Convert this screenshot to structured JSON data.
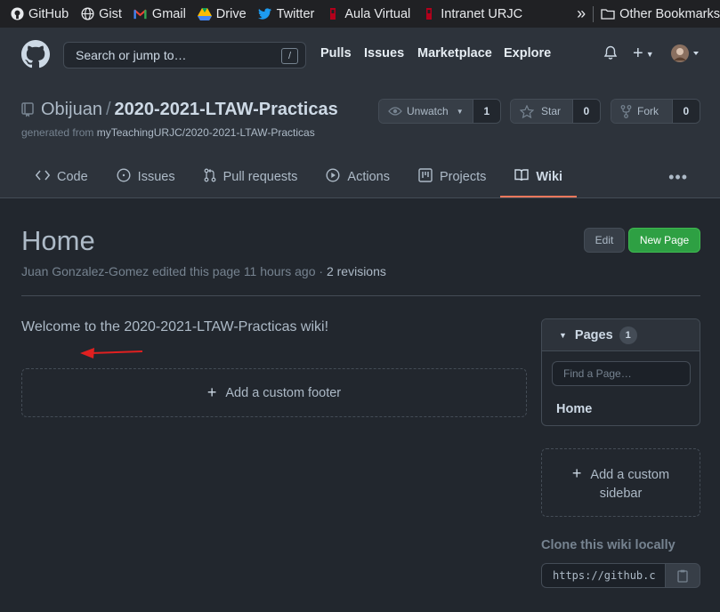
{
  "bookmarks": {
    "items": [
      {
        "label": "GitHub",
        "icon": "github-icon"
      },
      {
        "label": "Gist",
        "icon": "globe-icon"
      },
      {
        "label": "Gmail",
        "icon": "gmail-icon"
      },
      {
        "label": "Drive",
        "icon": "drive-icon"
      },
      {
        "label": "Twitter",
        "icon": "twitter-icon"
      },
      {
        "label": "Aula Virtual",
        "icon": "urjc-icon"
      },
      {
        "label": "Intranet URJC",
        "icon": "urjc-icon"
      }
    ],
    "other_label": "Other Bookmarks"
  },
  "header": {
    "search_placeholder": "Search or jump to…",
    "slash_key": "/",
    "nav": [
      "Pulls",
      "Issues",
      "Marketplace",
      "Explore"
    ]
  },
  "repo": {
    "owner": "Obijuan",
    "separator": "/",
    "name": "2020-2021-LTAW-Practicas",
    "generated_prefix": "generated from ",
    "generated_link": "myTeachingURJC/2020-2021-LTAW-Practicas",
    "unwatch_label": "Unwatch",
    "unwatch_count": "1",
    "star_label": "Star",
    "star_count": "0",
    "fork_label": "Fork",
    "fork_count": "0"
  },
  "tabs": [
    {
      "label": "Code",
      "icon": "code-icon"
    },
    {
      "label": "Issues",
      "icon": "issue-icon"
    },
    {
      "label": "Pull requests",
      "icon": "pull-request-icon"
    },
    {
      "label": "Actions",
      "icon": "play-icon"
    },
    {
      "label": "Projects",
      "icon": "project-icon"
    },
    {
      "label": "Wiki",
      "icon": "book-icon",
      "active": true
    }
  ],
  "wiki": {
    "title": "Home",
    "meta_text": "Juan Gonzalez-Gomez edited this page 11 hours ago · ",
    "revisions_link": "2 revisions",
    "edit_label": "Edit",
    "new_page_label": "New Page",
    "welcome": "Welcome to the 2020-2021-LTAW-Practicas wiki!",
    "add_footer": "Add a custom footer"
  },
  "sidebar": {
    "pages_label": "Pages",
    "pages_count": "1",
    "find_placeholder": "Find a Page…",
    "pages": [
      "Home"
    ],
    "add_sidebar_line1": "Add a custom",
    "add_sidebar_line2": "sidebar",
    "clone_title": "Clone this wiki locally",
    "clone_url": "https://github.c"
  },
  "colors": {
    "accent_tab_underline": "#ec775c",
    "new_page_green": "#2ea043",
    "annotation_arrow": "#e02020"
  }
}
